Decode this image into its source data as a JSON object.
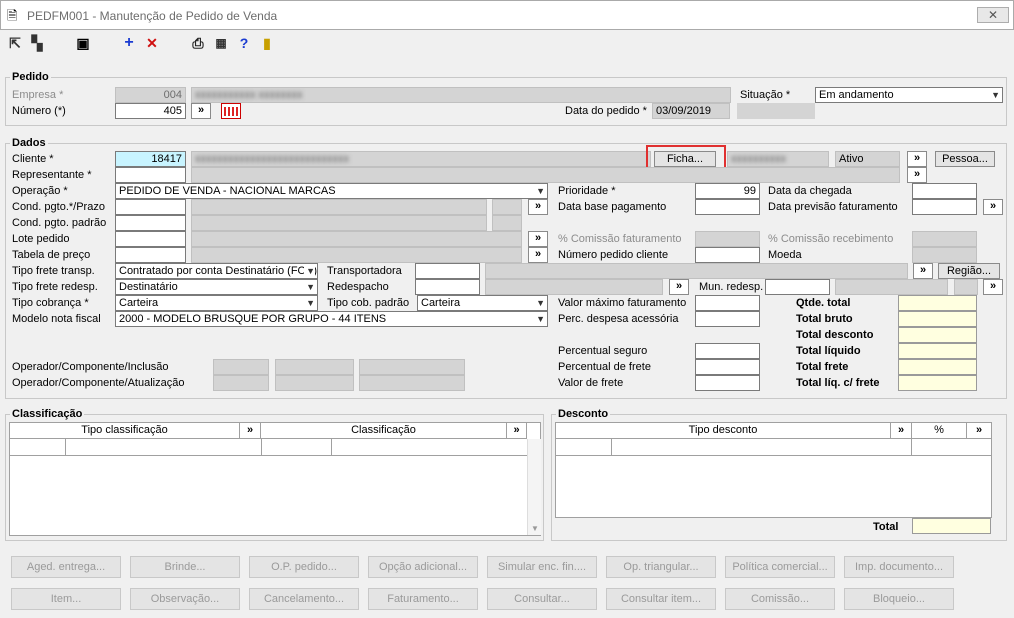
{
  "window": {
    "title": "PEDFM001 - Manutenção de Pedido de Venda",
    "close": "✕"
  },
  "toolbar": {
    "icons": [
      "arrow-icon",
      "move-icon",
      "save-icon",
      "add-icon",
      "delete-icon",
      "print-icon",
      "calculator-icon",
      "help-icon",
      "exit-icon"
    ]
  },
  "pedido": {
    "title": "Pedido",
    "empresa_label": "Empresa *",
    "empresa_code": "004",
    "numero_label": "Número (*)",
    "numero_value": "405",
    "situacao_label": "Situação *",
    "situacao_value": "Em andamento",
    "data_label": "Data do pedido *",
    "data_value": "03/09/2019",
    "nav_btn": "»"
  },
  "dados": {
    "title": "Dados",
    "cliente_label": "Cliente *",
    "cliente_code": "18417",
    "ficha_btn": "Ficha...",
    "status": "Ativo",
    "pessoa_btn": "Pessoa...",
    "representante_label": "Representante *",
    "operacao_label": "Operação *",
    "operacao_value": "PEDIDO DE VENDA - NACIONAL MARCAS",
    "cond_prazo_label": "Cond. pgto.*/Prazo",
    "cond_padrao_label": "Cond. pgto. padrão",
    "lote_label": "Lote pedido",
    "tabela_label": "Tabela de preço",
    "frete_transp_label": "Tipo frete transp.",
    "frete_transp_value": "Contratado por conta Destinatário (FOB)",
    "frete_redesp_label": "Tipo frete redesp.",
    "frete_redesp_value": "Destinatário",
    "cobranca_label": "Tipo cobrança *",
    "cobranca_value": "Carteira",
    "modelo_label": "Modelo nota fiscal",
    "modelo_value": "2000 - MODELO BRUSQUE POR GRUPO - 44 ITENS",
    "transportadora_label": "Transportadora",
    "redespacho_label": "Redespacho",
    "cob_padrao_label": "Tipo cob. padrão",
    "cob_padrao_value": "Carteira",
    "mun_redesp_label": "Mun. redesp.",
    "regiao_btn": "Região...",
    "prioridade_label": "Prioridade *",
    "prioridade_value": "99",
    "data_base_label": "Data base pagamento",
    "comissao_fat_label": "% Comissão faturamento",
    "num_pedido_cliente_label": "Número pedido cliente",
    "valor_max_label": "Valor máximo faturamento",
    "perc_despesa_label": "Perc. despesa acessória",
    "perc_seguro_label": "Percentual seguro",
    "perc_frete_label": "Percentual de frete",
    "valor_frete_label": "Valor de frete",
    "data_chegada_label": "Data da chegada",
    "data_prev_label": "Data previsão faturamento",
    "comissao_rec_label": "% Comissão recebimento",
    "moeda_label": "Moeda",
    "qtde_total_label": "Qtde. total",
    "total_bruto_label": "Total bruto",
    "total_desconto_label": "Total desconto",
    "total_liquido_label": "Total líquido",
    "total_frete_label": "Total frete",
    "total_liq_frete_label": "Total líq. c/ frete",
    "op_inclusao_label": "Operador/Componente/Inclusão",
    "op_atualizacao_label": "Operador/Componente/Atualização"
  },
  "classificacao": {
    "title": "Classificação",
    "columns": [
      "Tipo classificação",
      "Classificação"
    ]
  },
  "desconto": {
    "title": "Desconto",
    "columns": [
      "Tipo desconto",
      "%"
    ],
    "total_label": "Total"
  },
  "buttons_row1": [
    "Aged. entrega...",
    "Brinde...",
    "O.P. pedido...",
    "Opção adicional...",
    "Simular enc. fin....",
    "Op. triangular...",
    "Política comercial...",
    "Imp. documento..."
  ],
  "buttons_row2": [
    "Item...",
    "Observação...",
    "Cancelamento...",
    "Faturamento...",
    "Consultar...",
    "Consultar item...",
    "Comissão...",
    "Bloqueio..."
  ]
}
